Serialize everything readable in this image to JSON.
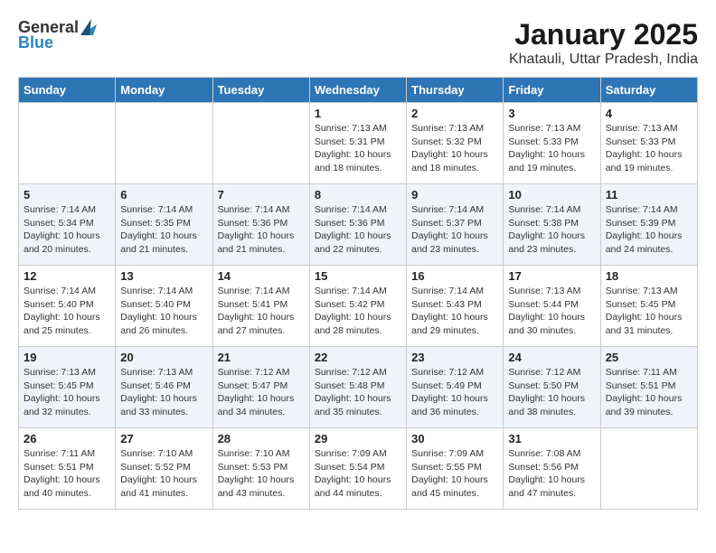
{
  "header": {
    "logo_line1": "General",
    "logo_line2": "Blue",
    "title": "January 2025",
    "subtitle": "Khatauli, Uttar Pradesh, India"
  },
  "days_of_week": [
    "Sunday",
    "Monday",
    "Tuesday",
    "Wednesday",
    "Thursday",
    "Friday",
    "Saturday"
  ],
  "weeks": [
    [
      {
        "num": "",
        "info": ""
      },
      {
        "num": "",
        "info": ""
      },
      {
        "num": "",
        "info": ""
      },
      {
        "num": "1",
        "info": "Sunrise: 7:13 AM\nSunset: 5:31 PM\nDaylight: 10 hours\nand 18 minutes."
      },
      {
        "num": "2",
        "info": "Sunrise: 7:13 AM\nSunset: 5:32 PM\nDaylight: 10 hours\nand 18 minutes."
      },
      {
        "num": "3",
        "info": "Sunrise: 7:13 AM\nSunset: 5:33 PM\nDaylight: 10 hours\nand 19 minutes."
      },
      {
        "num": "4",
        "info": "Sunrise: 7:13 AM\nSunset: 5:33 PM\nDaylight: 10 hours\nand 19 minutes."
      }
    ],
    [
      {
        "num": "5",
        "info": "Sunrise: 7:14 AM\nSunset: 5:34 PM\nDaylight: 10 hours\nand 20 minutes."
      },
      {
        "num": "6",
        "info": "Sunrise: 7:14 AM\nSunset: 5:35 PM\nDaylight: 10 hours\nand 21 minutes."
      },
      {
        "num": "7",
        "info": "Sunrise: 7:14 AM\nSunset: 5:36 PM\nDaylight: 10 hours\nand 21 minutes."
      },
      {
        "num": "8",
        "info": "Sunrise: 7:14 AM\nSunset: 5:36 PM\nDaylight: 10 hours\nand 22 minutes."
      },
      {
        "num": "9",
        "info": "Sunrise: 7:14 AM\nSunset: 5:37 PM\nDaylight: 10 hours\nand 23 minutes."
      },
      {
        "num": "10",
        "info": "Sunrise: 7:14 AM\nSunset: 5:38 PM\nDaylight: 10 hours\nand 23 minutes."
      },
      {
        "num": "11",
        "info": "Sunrise: 7:14 AM\nSunset: 5:39 PM\nDaylight: 10 hours\nand 24 minutes."
      }
    ],
    [
      {
        "num": "12",
        "info": "Sunrise: 7:14 AM\nSunset: 5:40 PM\nDaylight: 10 hours\nand 25 minutes."
      },
      {
        "num": "13",
        "info": "Sunrise: 7:14 AM\nSunset: 5:40 PM\nDaylight: 10 hours\nand 26 minutes."
      },
      {
        "num": "14",
        "info": "Sunrise: 7:14 AM\nSunset: 5:41 PM\nDaylight: 10 hours\nand 27 minutes."
      },
      {
        "num": "15",
        "info": "Sunrise: 7:14 AM\nSunset: 5:42 PM\nDaylight: 10 hours\nand 28 minutes."
      },
      {
        "num": "16",
        "info": "Sunrise: 7:14 AM\nSunset: 5:43 PM\nDaylight: 10 hours\nand 29 minutes."
      },
      {
        "num": "17",
        "info": "Sunrise: 7:13 AM\nSunset: 5:44 PM\nDaylight: 10 hours\nand 30 minutes."
      },
      {
        "num": "18",
        "info": "Sunrise: 7:13 AM\nSunset: 5:45 PM\nDaylight: 10 hours\nand 31 minutes."
      }
    ],
    [
      {
        "num": "19",
        "info": "Sunrise: 7:13 AM\nSunset: 5:45 PM\nDaylight: 10 hours\nand 32 minutes."
      },
      {
        "num": "20",
        "info": "Sunrise: 7:13 AM\nSunset: 5:46 PM\nDaylight: 10 hours\nand 33 minutes."
      },
      {
        "num": "21",
        "info": "Sunrise: 7:12 AM\nSunset: 5:47 PM\nDaylight: 10 hours\nand 34 minutes."
      },
      {
        "num": "22",
        "info": "Sunrise: 7:12 AM\nSunset: 5:48 PM\nDaylight: 10 hours\nand 35 minutes."
      },
      {
        "num": "23",
        "info": "Sunrise: 7:12 AM\nSunset: 5:49 PM\nDaylight: 10 hours\nand 36 minutes."
      },
      {
        "num": "24",
        "info": "Sunrise: 7:12 AM\nSunset: 5:50 PM\nDaylight: 10 hours\nand 38 minutes."
      },
      {
        "num": "25",
        "info": "Sunrise: 7:11 AM\nSunset: 5:51 PM\nDaylight: 10 hours\nand 39 minutes."
      }
    ],
    [
      {
        "num": "26",
        "info": "Sunrise: 7:11 AM\nSunset: 5:51 PM\nDaylight: 10 hours\nand 40 minutes."
      },
      {
        "num": "27",
        "info": "Sunrise: 7:10 AM\nSunset: 5:52 PM\nDaylight: 10 hours\nand 41 minutes."
      },
      {
        "num": "28",
        "info": "Sunrise: 7:10 AM\nSunset: 5:53 PM\nDaylight: 10 hours\nand 43 minutes."
      },
      {
        "num": "29",
        "info": "Sunrise: 7:09 AM\nSunset: 5:54 PM\nDaylight: 10 hours\nand 44 minutes."
      },
      {
        "num": "30",
        "info": "Sunrise: 7:09 AM\nSunset: 5:55 PM\nDaylight: 10 hours\nand 45 minutes."
      },
      {
        "num": "31",
        "info": "Sunrise: 7:08 AM\nSunset: 5:56 PM\nDaylight: 10 hours\nand 47 minutes."
      },
      {
        "num": "",
        "info": ""
      }
    ]
  ]
}
